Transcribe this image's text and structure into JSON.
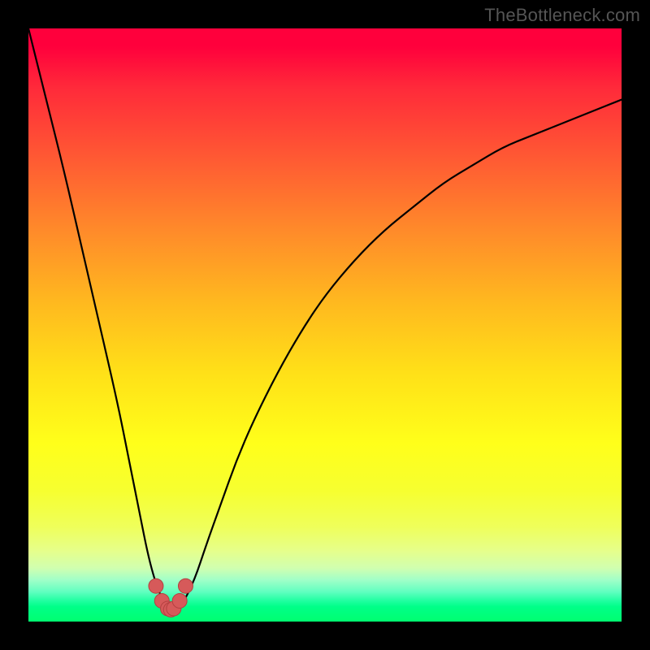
{
  "attribution": "TheBottleneck.com",
  "colors": {
    "frame": "#000000",
    "gradient_top": "#ff003c",
    "gradient_bottom": "#00ff70",
    "curve": "#000000",
    "marker_fill": "#d65a5a",
    "marker_stroke": "#b44040"
  },
  "chart_data": {
    "type": "line",
    "title": "",
    "xlabel": "",
    "ylabel": "",
    "xlim": [
      0,
      100
    ],
    "ylim": [
      0,
      100
    ],
    "grid": false,
    "series": [
      {
        "name": "bottleneck-curve",
        "x": [
          0,
          3,
          6,
          9,
          12,
          15,
          17,
          19,
          20,
          21,
          22,
          23,
          24,
          25,
          26,
          28,
          30,
          32.5,
          35,
          38,
          42,
          46,
          50,
          55,
          60,
          65,
          70,
          75,
          80,
          85,
          90,
          95,
          100
        ],
        "y": [
          100,
          88,
          76,
          63,
          50,
          37,
          27,
          17,
          12,
          8,
          5,
          3,
          2,
          2,
          3,
          7,
          13,
          20,
          27,
          34,
          42,
          49,
          55,
          61,
          66,
          70,
          74,
          77,
          80,
          82,
          84,
          86,
          88
        ]
      }
    ],
    "markers": {
      "name": "highlighted-minimum",
      "x": [
        21.5,
        22.5,
        23.5,
        24,
        24.5,
        25.5,
        26.5
      ],
      "y": [
        6,
        3.5,
        2.2,
        2,
        2.2,
        3.5,
        6
      ]
    }
  }
}
